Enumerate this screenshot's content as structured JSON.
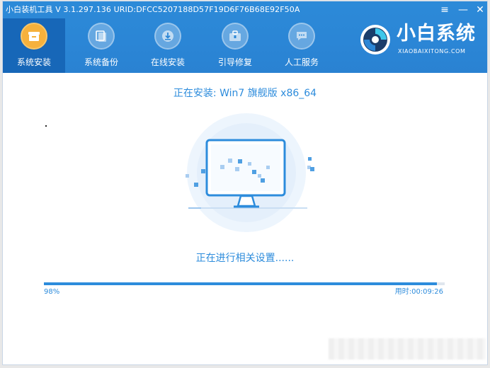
{
  "window": {
    "title": "小白装机工具 V 3.1.297.136 URID:DFCC5207188D57F19D6F76B68E92F50A",
    "controls": {
      "menu_icon": "menu-icon",
      "minimize_icon": "minimize-icon",
      "close_icon": "close-icon"
    }
  },
  "nav": {
    "items": [
      {
        "label": "系统安装",
        "icon": "install-box-icon",
        "active": true
      },
      {
        "label": "系统备份",
        "icon": "backup-icon",
        "active": false
      },
      {
        "label": "在线安装",
        "icon": "download-icon",
        "active": false
      },
      {
        "label": "引导修复",
        "icon": "toolbox-icon",
        "active": false
      },
      {
        "label": "人工服务",
        "icon": "chat-icon",
        "active": false
      }
    ]
  },
  "brand": {
    "name": "小白系统",
    "subtitle": "XIAOBAIXITONG.COM"
  },
  "main": {
    "install_title": "正在安装: Win7 旗舰版 x86_64",
    "status_text": "正在进行相关设置......",
    "progress": {
      "percent_label": "98%",
      "value": 0.98
    },
    "elapsed_label": "用时:00:09:26"
  },
  "colors": {
    "header": "#2b86d6",
    "active_tab": "#1767b8",
    "active_icon": "#f6b13c",
    "accent": "#2d8cdc"
  }
}
